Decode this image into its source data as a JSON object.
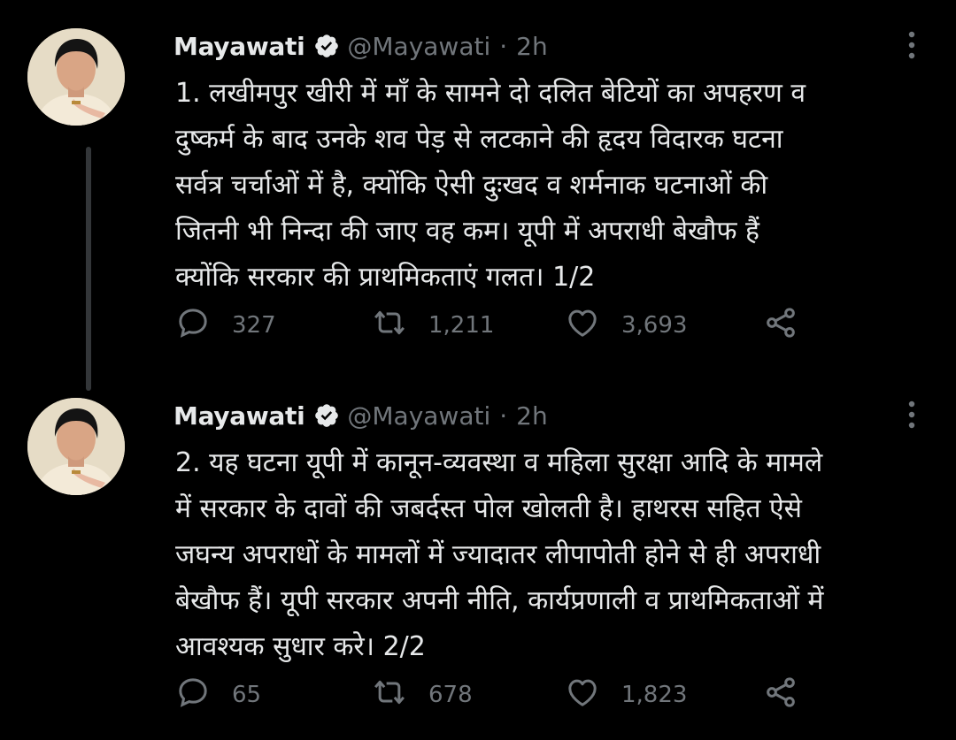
{
  "colors": {
    "background": "#000000",
    "primary_text": "#e7e9ea",
    "secondary_text": "#71767b",
    "verified_badge": "#e7e9ea",
    "thread_line": "#333639"
  },
  "tweets": [
    {
      "author_name": "Mayawati",
      "handle": "@Mayawati",
      "separator": "·",
      "time": "2h",
      "text": "1. लखीमपुर खीरी में माँ के सामने दो दलित बेटियों का अपहरण व\nदुष्कर्म के बाद उनके शव पेड़ से लटकाने की हृदय विदारक घटना\nसर्वत्र चर्चाओं में है, क्योंकि ऐसी दुःखद व शर्मनाक घटनाओं की\nजितनी भी निन्दा की जाए वह कम। यूपी में अपराधी बेखौफ हैं\nक्योंकि सरकार की प्राथमिकताएं गलत। 1/2",
      "replies": "327",
      "retweets": "1,211",
      "likes": "3,693",
      "icons": [
        "verified-badge-icon",
        "more-options-icon",
        "reply-icon",
        "retweet-icon",
        "like-icon",
        "share-icon"
      ]
    },
    {
      "author_name": "Mayawati",
      "handle": "@Mayawati",
      "separator": "·",
      "time": "2h",
      "text": "2. यह घटना यूपी में कानून-व्यवस्था व महिला सुरक्षा आदि के मामले\nमें सरकार के दावों की जबर्दस्त पोल खोलती है। हाथरस सहित ऐसे\nजघन्य अपराधों के मामलों में ज्यादातर लीपापोती होने से ही अपराधी\nबेखौफ हैं। यूपी सरकार अपनी नीति, कार्यप्रणाली व प्राथमिकताओं में\nआवश्यक सुधार करे। 2/2",
      "replies": "65",
      "retweets": "678",
      "likes": "1,823",
      "icons": [
        "verified-badge-icon",
        "more-options-icon",
        "reply-icon",
        "retweet-icon",
        "like-icon",
        "share-icon"
      ]
    }
  ]
}
